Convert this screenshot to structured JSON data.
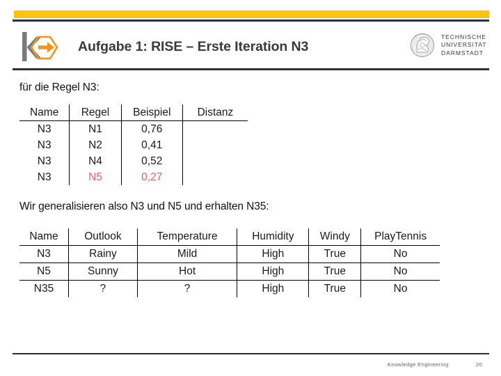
{
  "header": {
    "title": "Aufgabe 1: RISE – Erste Iteration N3",
    "accent_color": "#ffc20e",
    "rule_color": "#2b3142",
    "ke_logo_name": "knowledge-engineering-logo",
    "tud_logo": {
      "line1": "TECHNISCHE",
      "line2": "UNIVERSITAT",
      "line3": "DARMSTADT"
    }
  },
  "body": {
    "intro_line": "für die Regel N3:",
    "generalize_line": "Wir generalisieren also N3 und N5 und erhalten N35:"
  },
  "table_regeln": {
    "headers": [
      "Name",
      "Regel",
      "Beispiel",
      "Distanz"
    ],
    "rows": [
      {
        "name": "N3",
        "regel": "N1",
        "beispiel": "0,76",
        "distanz": "",
        "highlight": false
      },
      {
        "name": "N3",
        "regel": "N2",
        "beispiel": "0,41",
        "distanz": "",
        "highlight": false
      },
      {
        "name": "N3",
        "regel": "N4",
        "beispiel": "0,52",
        "distanz": "",
        "highlight": false
      },
      {
        "name": "N3",
        "regel": "N5",
        "beispiel": "0,27",
        "distanz": "",
        "highlight": true
      }
    ],
    "highlight_color": "#e2645e"
  },
  "table_instances": {
    "headers": [
      "Name",
      "Outlook",
      "Temperature",
      "Humidity",
      "Windy",
      "PlayTennis"
    ],
    "rows": [
      {
        "name": "N3",
        "outlook": "Rainy",
        "temperature": "Mild",
        "humidity": "High",
        "windy": "True",
        "playtennis": "No"
      },
      {
        "name": "N5",
        "outlook": "Sunny",
        "temperature": "Hot",
        "humidity": "High",
        "windy": "True",
        "playtennis": "No"
      },
      {
        "name": "N35",
        "outlook": "?",
        "temperature": "?",
        "humidity": "High",
        "windy": "True",
        "playtennis": "No"
      }
    ]
  },
  "footer": {
    "department": "Knowledge Engineering",
    "page_number": "20"
  }
}
